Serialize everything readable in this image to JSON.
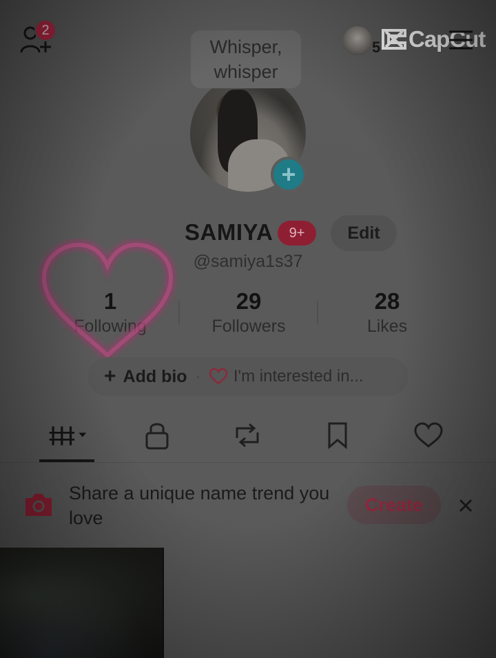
{
  "header": {
    "friend_requests_count": "2",
    "top_count": "5",
    "watermark": "CapCut"
  },
  "profile": {
    "note_bubble": "Whisper, whisper",
    "name": "SAMIYA",
    "name_badge": "9+",
    "edit_label": "Edit",
    "handle": "@samiya1s37"
  },
  "stats": [
    {
      "value": "1",
      "label": "Following"
    },
    {
      "value": "29",
      "label": "Followers"
    },
    {
      "value": "28",
      "label": "Likes"
    }
  ],
  "bio": {
    "add_label": "Add bio",
    "separator": "·",
    "interest_label": "I'm interested in..."
  },
  "tabs": [
    "videos-grid",
    "private",
    "reposts",
    "saved",
    "liked"
  ],
  "banner": {
    "text": "Share a unique name trend you love",
    "create_label": "Create"
  },
  "colors": {
    "accent": "#b22744",
    "teal": "#1f7b86"
  }
}
